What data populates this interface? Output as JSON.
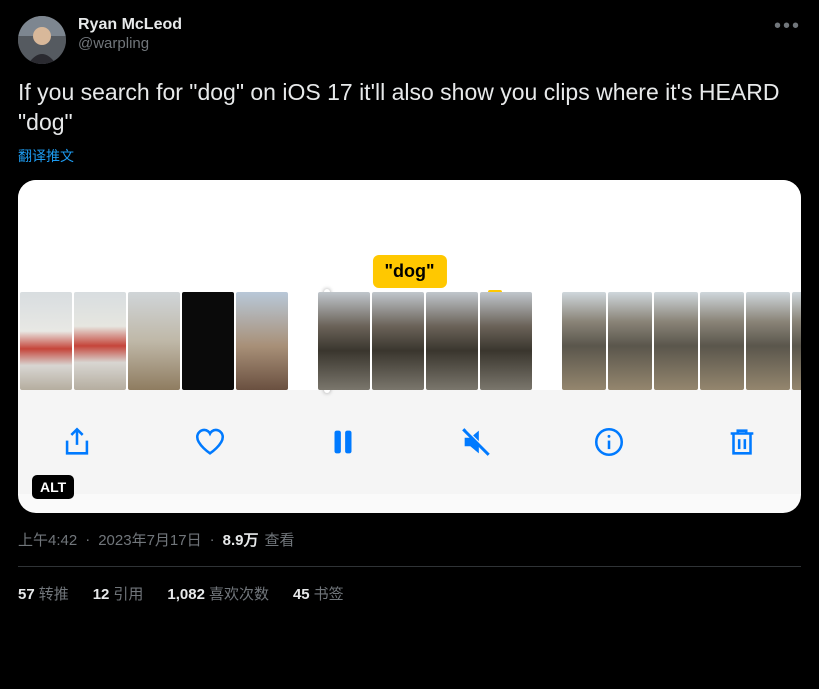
{
  "user": {
    "display_name": "Ryan McLeod",
    "handle": "@warpling"
  },
  "content_text": "If you search for \"dog\" on iOS 17 it'll also show you clips where it's HEARD \"dog\"",
  "translate_label": "翻译推文",
  "media": {
    "search_tag": "\"dog\"",
    "alt_badge": "ALT"
  },
  "meta": {
    "time": "上午4:42",
    "date": "2023年7月17日",
    "views_count": "8.9万",
    "views_label": "查看"
  },
  "stats": {
    "retweets_count": "57",
    "retweets_label": "转推",
    "quotes_count": "12",
    "quotes_label": "引用",
    "likes_count": "1,082",
    "likes_label": "喜欢次数",
    "bookmarks_count": "45",
    "bookmarks_label": "书签"
  }
}
